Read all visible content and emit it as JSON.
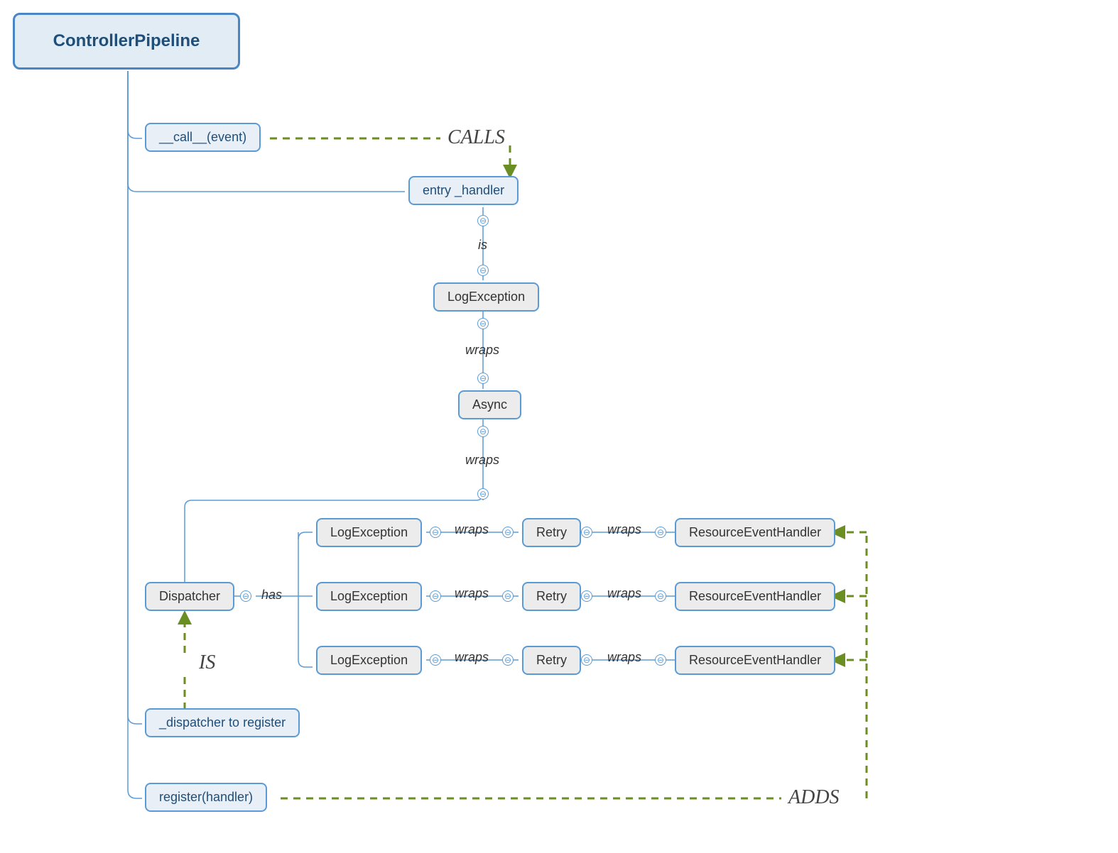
{
  "nodes": {
    "root": "ControllerPipeline",
    "call_event": "__call__(event)",
    "entry_handler": "entry _handler",
    "log_exception_top": "LogException",
    "async": "Async",
    "dispatcher": "Dispatcher",
    "dispatcher_to_register": "_dispatcher to register",
    "register_handler": "register(handler)",
    "row1": {
      "log": "LogException",
      "retry": "Retry",
      "reh": "ResourceEventHandler"
    },
    "row2": {
      "log": "LogException",
      "retry": "Retry",
      "reh": "ResourceEventHandler"
    },
    "row3": {
      "log": "LogException",
      "retry": "Retry",
      "reh": "ResourceEventHandler"
    }
  },
  "labels": {
    "calls": "CALLS",
    "is_small": "is",
    "wraps": "wraps",
    "has": "has",
    "is_big": "IS",
    "adds": "ADDS"
  },
  "icons": {
    "collapse": "⊖"
  },
  "colors": {
    "node_border": "#5b9bd5",
    "node_fill_blue": "#e8eff7",
    "node_fill_gray": "#ececec",
    "text_dark_blue": "#1f4e79",
    "dashed_green": "#6b8e23"
  }
}
